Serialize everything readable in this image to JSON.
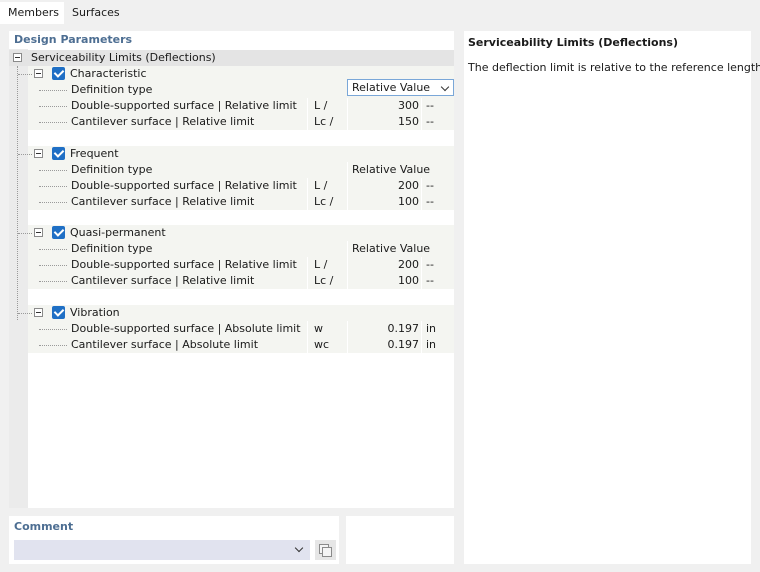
{
  "tabs": [
    {
      "label": "Members"
    },
    {
      "label": "Surfaces"
    }
  ],
  "design_parameters": {
    "title": "Design Parameters",
    "root_label": "Serviceability Limits (Deflections)",
    "groups": [
      {
        "label": "Characteristic",
        "definition_label": "Definition type",
        "definition_value": "Relative Value",
        "rows": [
          {
            "label": "Double-supported surface | Relative limit",
            "symbol": "L /",
            "value": "300",
            "unit": "--"
          },
          {
            "label": "Cantilever surface | Relative limit",
            "symbol": "Lc /",
            "value": "150",
            "unit": "--"
          }
        ]
      },
      {
        "label": "Frequent",
        "definition_label": "Definition type",
        "definition_value": "Relative Value",
        "rows": [
          {
            "label": "Double-supported surface | Relative limit",
            "symbol": "L /",
            "value": "200",
            "unit": "--"
          },
          {
            "label": "Cantilever surface | Relative limit",
            "symbol": "Lc /",
            "value": "100",
            "unit": "--"
          }
        ]
      },
      {
        "label": "Quasi-permanent",
        "definition_label": "Definition type",
        "definition_value": "Relative Value",
        "rows": [
          {
            "label": "Double-supported surface | Relative limit",
            "symbol": "L /",
            "value": "200",
            "unit": "--"
          },
          {
            "label": "Cantilever surface | Relative limit",
            "symbol": "Lc /",
            "value": "100",
            "unit": "--"
          }
        ]
      },
      {
        "label": "Vibration",
        "rows": [
          {
            "label": "Double-supported surface | Absolute limit",
            "symbol": "w",
            "value": "0.197",
            "unit": "in"
          },
          {
            "label": "Cantilever surface | Absolute limit",
            "symbol": "wc",
            "value": "0.197",
            "unit": "in"
          }
        ]
      }
    ]
  },
  "info_panel": {
    "title": "Serviceability Limits (Deflections)",
    "description": "The deflection limit is relative to the reference length."
  },
  "comment": {
    "title": "Comment",
    "value": ""
  },
  "colors": {
    "section_title": "#4d6e92",
    "checkbox": "#1f6fc5",
    "row_bg": "#f4f5f1",
    "header_bg": "#e4e4e4"
  }
}
